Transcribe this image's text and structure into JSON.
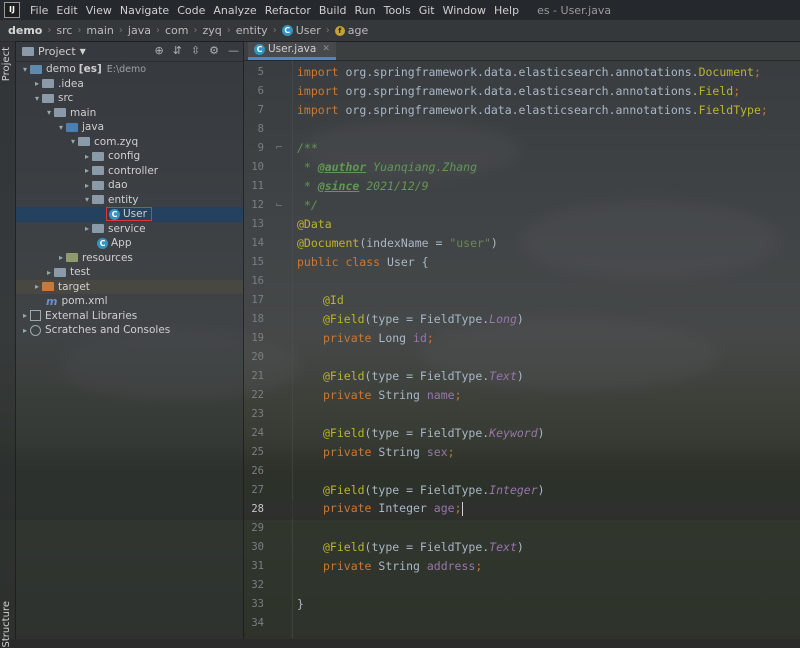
{
  "menubar": {
    "logo": "IJ",
    "items": [
      "File",
      "Edit",
      "View",
      "Navigate",
      "Code",
      "Analyze",
      "Refactor",
      "Build",
      "Run",
      "Tools",
      "Git",
      "Window",
      "Help"
    ],
    "window_title": "es - User.java"
  },
  "breadcrumb": [
    "demo",
    "src",
    "main",
    "java",
    "com",
    "zyq",
    "entity",
    "User",
    "age"
  ],
  "left_strip": {
    "project_tab": "Project",
    "structure_tab": "Structure"
  },
  "project_panel": {
    "title": "Project",
    "tree": [
      {
        "label": "demo",
        "extra": "[es]",
        "path": "E:\\demo"
      },
      {
        "label": ".idea"
      },
      {
        "label": "src"
      },
      {
        "label": "main"
      },
      {
        "label": "java"
      },
      {
        "label": "com.zyq"
      },
      {
        "label": "config"
      },
      {
        "label": "controller"
      },
      {
        "label": "dao"
      },
      {
        "label": "entity"
      },
      {
        "label": "User"
      },
      {
        "label": "service"
      },
      {
        "label": "App"
      },
      {
        "label": "resources"
      },
      {
        "label": "test"
      },
      {
        "label": "target"
      },
      {
        "label": "pom.xml"
      },
      {
        "label": "External Libraries"
      },
      {
        "label": "Scratches and Consoles"
      }
    ]
  },
  "editor": {
    "tab_label": "User.java",
    "line_numbers": [
      "5",
      "6",
      "7",
      "8",
      "9",
      "10",
      "11",
      "12",
      "13",
      "14",
      "15",
      "16",
      "17",
      "18",
      "19",
      "20",
      "21",
      "22",
      "23",
      "24",
      "25",
      "26",
      "27",
      "28",
      "29",
      "30",
      "31",
      "32",
      "33",
      "34"
    ],
    "current_line": "28",
    "code": {
      "l5": [
        "import ",
        "org.springframework.data.elasticsearch.annotations.",
        "Document",
        ";"
      ],
      "l6": [
        "import ",
        "org.springframework.data.elasticsearch.annotations.",
        "Field",
        ";"
      ],
      "l7": [
        "import ",
        "org.springframework.data.elasticsearch.annotations.",
        "FieldType",
        ";"
      ],
      "l9": "/**",
      "l10": [
        " * ",
        "@author",
        " Yuanqiang.Zhang"
      ],
      "l11": [
        " * ",
        "@since",
        " 2021/12/9"
      ],
      "l12": " */",
      "l13": "@Data",
      "l14": [
        "@Document",
        "(indexName = ",
        "\"user\"",
        ")"
      ],
      "l15": [
        "public class ",
        "User {"
      ],
      "l17": "@Id",
      "l18": [
        "@Field",
        "(type = FieldType.",
        "Long",
        ")"
      ],
      "l19": [
        "private ",
        "Long ",
        "id",
        ";"
      ],
      "l21": [
        "@Field",
        "(type = FieldType.",
        "Text",
        ")"
      ],
      "l22": [
        "private ",
        "String ",
        "name",
        ";"
      ],
      "l24": [
        "@Field",
        "(type = FieldType.",
        "Keyword",
        ")"
      ],
      "l25": [
        "private ",
        "String ",
        "sex",
        ";"
      ],
      "l27": [
        "@Field",
        "(type = FieldType.",
        "Integer",
        ")"
      ],
      "l28": [
        "private ",
        "Integer ",
        "age",
        ";"
      ],
      "l30": [
        "@Field",
        "(type = FieldType.",
        "Text",
        ")"
      ],
      "l31": [
        "private ",
        "String ",
        "address",
        ";"
      ],
      "l33": "}"
    }
  }
}
